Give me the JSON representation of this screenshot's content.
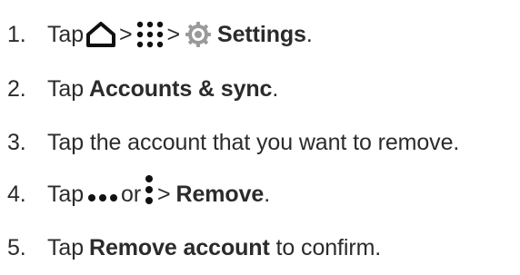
{
  "steps": [
    {
      "number": "1.",
      "tap": "Tap",
      "sep1": ">",
      "sep2": ">",
      "bold": "Settings",
      "tail": ".",
      "icons": [
        "home-icon",
        "app-grid-icon",
        "settings-gear-icon"
      ]
    },
    {
      "number": "2.",
      "tap": "Tap",
      "bold": "Accounts & sync",
      "tail": "."
    },
    {
      "number": "3.",
      "text": "Tap the account that you want to remove."
    },
    {
      "number": "4.",
      "tap": "Tap",
      "or": "or",
      "sep": ">",
      "bold": "Remove",
      "tail": ".",
      "icons": [
        "more-horizontal-icon",
        "more-vertical-icon"
      ]
    },
    {
      "number": "5.",
      "tap": "Tap",
      "bold": "Remove account",
      "tail": "to confirm."
    }
  ],
  "colors": {
    "text": "#2b2b2b",
    "icon": "#111111",
    "gear": "#9a9a9a"
  }
}
